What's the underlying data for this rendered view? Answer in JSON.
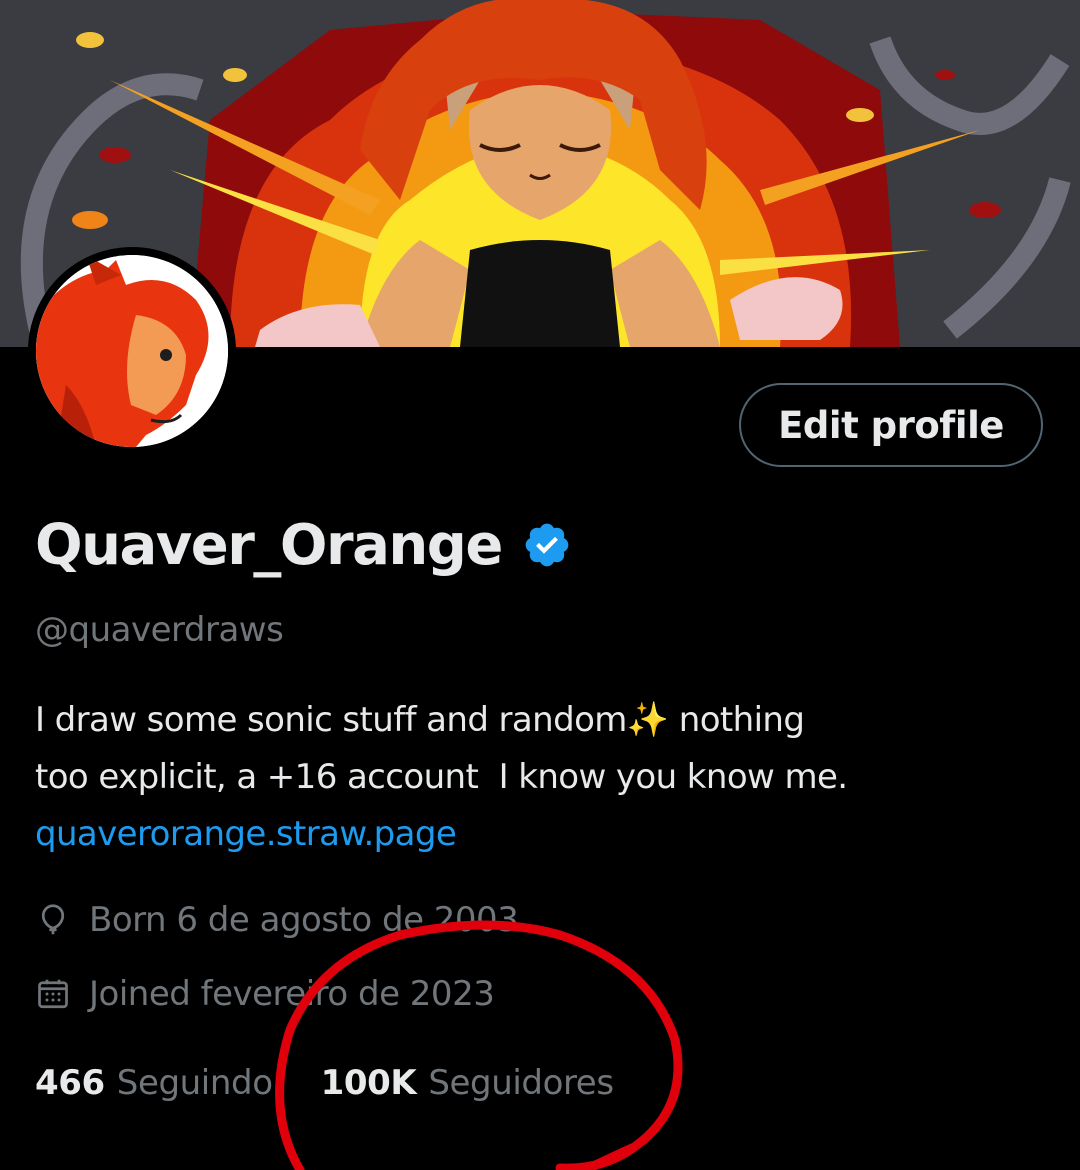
{
  "profile": {
    "display_name": "Quaver_Orange",
    "handle": "@quaverdraws",
    "edit_button_label": "Edit profile",
    "bio_line_1": "I draw some sonic stuff and random✨ nothing",
    "bio_line_2": "too explicit, a +16 account  I know you know me.",
    "bio_link": "quaverorange.straw.page",
    "born": "Born 6 de agosto de 2003",
    "joined": "Joined fevereiro de 2023",
    "following_count": "466",
    "following_label": "Seguindo",
    "followers_count": "100K",
    "followers_label": "Seguidores"
  },
  "icons": {
    "verified": "verified-badge-icon",
    "born": "balloon-icon",
    "joined": "calendar-icon"
  },
  "colors": {
    "background": "#000000",
    "text_primary": "#e7e9ea",
    "text_secondary": "#71767b",
    "link": "#1d9bf0",
    "verified": "#1d9bf0",
    "annotation": "#e0000b"
  }
}
